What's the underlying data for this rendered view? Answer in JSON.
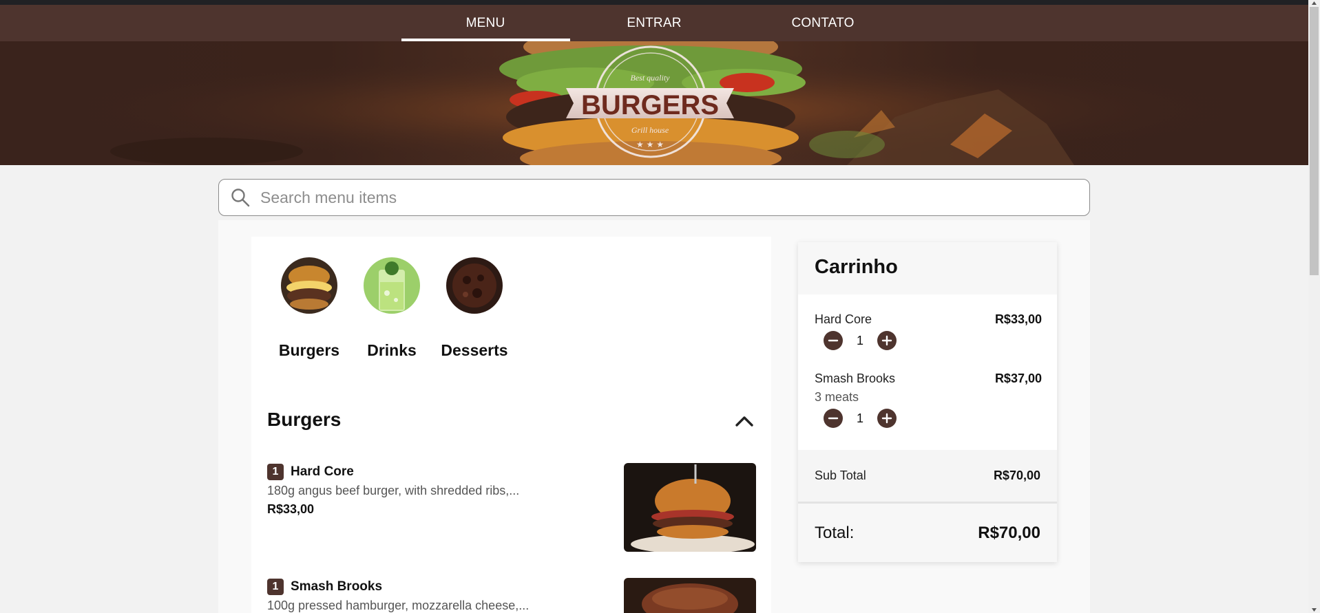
{
  "nav": {
    "items": [
      {
        "label": "MENU",
        "active": true
      },
      {
        "label": "ENTRAR",
        "active": false
      },
      {
        "label": "CONTATO",
        "active": false
      }
    ]
  },
  "hero": {
    "logo_title": "BURGERS",
    "logo_top": "Best quality",
    "logo_bottom": "Grill house"
  },
  "search": {
    "placeholder": "Search menu items",
    "value": ""
  },
  "categories": [
    {
      "label": "Burgers",
      "icon": "burger-photo"
    },
    {
      "label": "Drinks",
      "icon": "drink-photo"
    },
    {
      "label": "Desserts",
      "icon": "dessert-photo"
    }
  ],
  "section": {
    "title": "Burgers",
    "collapse_icon": "chevron-up-icon"
  },
  "items": [
    {
      "qty": "1",
      "name": "Hard Core",
      "description": "180g angus beef burger, with shredded ribs,...",
      "price": "R$33,00"
    },
    {
      "qty": "1",
      "name": "Smash Brooks",
      "description": "100g pressed hamburger, mozzarella cheese,...",
      "price": ""
    }
  ],
  "cart": {
    "title": "Carrinho",
    "lines": [
      {
        "name": "Hard Core",
        "price": "R$33,00",
        "extra": "",
        "qty": "1"
      },
      {
        "name": "Smash Brooks",
        "price": "R$37,00",
        "extra": "3 meats",
        "qty": "1"
      }
    ],
    "subtotal_label": "Sub Total",
    "subtotal_value": "R$70,00",
    "total_label": "Total:",
    "total_value": "R$70,00"
  },
  "colors": {
    "brand": "#4e342e",
    "nav_text": "#ffffff",
    "page_bg": "#f2f2f2"
  }
}
